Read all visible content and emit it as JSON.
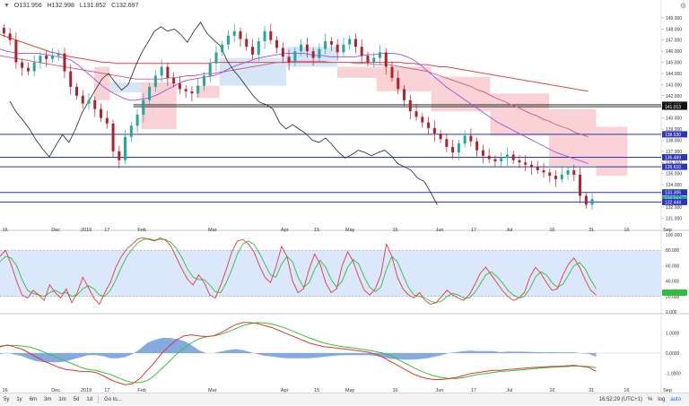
{
  "header": {
    "ohlc": [
      "O131.956",
      "H132.998",
      "L131.852",
      "C132.697"
    ]
  },
  "chart_data": {
    "type": "candlestick",
    "y_ticks": [
      131.0,
      132.0,
      133.0,
      134.0,
      135.0,
      136.0,
      137.0,
      138.0,
      139.0,
      140.0,
      141.0,
      142.0,
      143.0,
      144.0,
      145.0,
      146.0,
      147.0,
      148.0,
      149.0
    ],
    "ylim": [
      130.3,
      149.8
    ],
    "x_labels": [
      {
        "label": "16",
        "t": 0.03
      },
      {
        "label": "Dec",
        "t": 0.28
      },
      {
        "label": "2019",
        "t": 0.43
      },
      {
        "label": "17",
        "t": 0.55
      },
      {
        "label": "Feb",
        "t": 0.72
      },
      {
        "label": "Mar",
        "t": 1.08
      },
      {
        "label": "Apr",
        "t": 1.45
      },
      {
        "label": "15",
        "t": 1.62
      },
      {
        "label": "May",
        "t": 1.78
      },
      {
        "label": "16",
        "t": 2.02
      },
      {
        "label": "Jun",
        "t": 2.24
      },
      {
        "label": "17",
        "t": 2.42
      },
      {
        "label": "Jul",
        "t": 2.6
      },
      {
        "label": "16",
        "t": 2.82
      },
      {
        "label": "31",
        "t": 3.02
      },
      {
        "label": "16",
        "t": 3.2
      },
      {
        "label": "Sep",
        "t": 3.4
      }
    ],
    "closes": [
      147.6,
      147.0,
      145.0,
      144.5,
      144.2,
      145.0,
      145.6,
      145.3,
      145.6,
      145.8,
      144.2,
      142.8,
      142.0,
      141.3,
      141.6,
      140.8,
      140.0,
      139.5,
      137.0,
      136.2,
      138.3,
      139.3,
      140.3,
      141.6,
      142.8,
      143.8,
      144.6,
      143.6,
      143.1,
      142.6,
      142.4,
      142.2,
      142.9,
      143.8,
      144.9,
      145.9,
      146.6,
      147.4,
      147.8,
      147.1,
      146.4,
      145.7,
      146.9,
      147.8,
      147.0,
      146.3,
      145.5,
      145.0,
      146.0,
      146.6,
      146.0,
      145.4,
      146.2,
      146.9,
      146.6,
      145.9,
      146.6,
      147.1,
      146.4,
      145.6,
      145.0,
      145.4,
      145.9,
      144.6,
      143.6,
      142.6,
      141.6,
      140.6,
      140.1,
      139.6,
      139.1,
      138.6,
      138.1,
      137.4,
      136.9,
      137.7,
      138.4,
      137.9,
      137.1,
      136.6,
      136.3,
      136.1,
      136.4,
      136.7,
      136.2,
      136.0,
      135.8,
      135.6,
      135.3,
      135.1,
      134.8,
      134.5,
      134.9,
      135.3,
      134.9,
      133.0,
      132.2,
      132.7
    ],
    "ma_fast": [
      146.2,
      146.0,
      145.9,
      145.8,
      145.8,
      145.8,
      145.8,
      145.7,
      145.6,
      145.5,
      145.4,
      145.2,
      144.8,
      144.3,
      143.8,
      143.3,
      142.8,
      142.4,
      142.1,
      141.8,
      141.6,
      141.6,
      141.7,
      141.8,
      142.0,
      142.3,
      142.6,
      142.9,
      143.2,
      143.4,
      143.5,
      143.6,
      143.7,
      143.8,
      144.0,
      144.3,
      144.6,
      144.8,
      145.0,
      145.2,
      145.4,
      145.5,
      145.6,
      145.7,
      145.8,
      145.8,
      145.8,
      145.8,
      145.7,
      145.6,
      145.6,
      145.5,
      145.5,
      145.5,
      145.5,
      145.5,
      145.6,
      145.7,
      145.7,
      145.8,
      145.8,
      145.8,
      145.7,
      145.5,
      145.2,
      144.8,
      144.3,
      143.8,
      143.3,
      142.8,
      142.4,
      142.0,
      141.6,
      141.2,
      140.8,
      140.4,
      140.0,
      139.6,
      139.3,
      139.0,
      138.7,
      138.4,
      138.1,
      137.8,
      137.5,
      137.2,
      136.9,
      136.7,
      136.5,
      136.3,
      136.1,
      135.9
    ],
    "ma_mid": [
      145.6,
      145.5,
      145.4,
      145.3,
      145.2,
      145.1,
      145.0,
      144.9,
      144.8,
      144.7,
      144.6,
      144.5,
      144.4,
      144.3,
      144.2,
      144.1,
      144.0,
      143.9,
      143.8,
      143.7,
      143.6,
      143.5,
      143.5,
      143.5,
      143.5,
      143.5,
      143.6,
      143.6,
      143.7,
      143.8,
      143.8,
      143.9,
      144.0,
      144.0,
      144.1,
      144.2,
      144.3,
      144.4,
      144.5,
      144.6,
      144.7,
      144.8,
      144.9,
      145.0,
      145.0,
      145.1,
      145.1,
      145.1,
      145.1,
      145.1,
      145.1,
      145.0,
      145.0,
      145.0,
      145.0,
      144.9,
      144.9,
      144.9,
      144.8,
      144.8,
      144.8,
      144.7,
      144.6,
      144.5,
      144.4,
      144.3,
      144.2,
      144.0,
      143.8,
      143.6,
      143.4,
      143.2,
      143.0,
      142.8,
      142.5,
      142.3,
      142.0,
      141.7,
      141.5,
      141.2,
      141.0,
      140.7,
      140.4,
      140.2,
      139.9,
      139.7,
      139.4,
      139.2,
      139.0,
      138.7,
      138.5,
      138.3
    ],
    "ma_slow": [
      147.5,
      147.3,
      147.1,
      146.9,
      146.7,
      146.5,
      146.3,
      146.1,
      145.9,
      145.8,
      145.6,
      145.5,
      145.4,
      145.3,
      145.2,
      145.1,
      145.0,
      145.0,
      144.9,
      144.9,
      144.9,
      144.9,
      144.9,
      144.9,
      144.9,
      144.9,
      144.9,
      144.9,
      144.9,
      144.9,
      144.9,
      144.9,
      144.9,
      145.0,
      145.0,
      145.0,
      145.0,
      145.0,
      145.0,
      145.0,
      145.0,
      145.0,
      145.0,
      145.0,
      145.0,
      145.0,
      145.0,
      145.0,
      145.0,
      145.0,
      145.0,
      145.0,
      145.0,
      145.0,
      145.0,
      145.0,
      145.0,
      145.0,
      145.0,
      145.0,
      145.0,
      145.0,
      145.0,
      144.9,
      144.9,
      144.8,
      144.8,
      144.7,
      144.6,
      144.6,
      144.5,
      144.4,
      144.3,
      144.2,
      144.1,
      144.0,
      143.9,
      143.8,
      143.7,
      143.6,
      143.5,
      143.4,
      143.3,
      143.2,
      143.1,
      143.0,
      142.9,
      142.8,
      142.7,
      142.6,
      142.5,
      142.4
    ],
    "lagging": [
      141.5,
      140.5,
      139.8,
      139.0,
      138.0,
      137.2,
      136.5,
      137.5,
      138.5,
      137.8,
      139.0,
      140.5,
      141.5,
      142.5,
      143.5,
      144.0,
      143.2,
      142.5,
      143.0,
      144.5,
      145.8,
      146.8,
      147.8,
      148.2,
      147.8,
      148.0,
      147.5,
      146.8,
      147.8,
      148.6,
      147.6,
      147.0,
      146.5,
      145.2,
      144.3,
      143.6,
      142.8,
      142.0,
      141.4,
      141.2,
      140.8,
      139.6,
      139.0,
      139.4,
      139.0,
      138.6,
      138.0,
      137.8,
      138.2,
      137.6,
      136.9,
      136.4,
      136.7,
      137.1,
      136.9,
      136.6,
      136.9,
      137.1,
      136.6,
      135.9,
      135.6,
      135.3,
      134.6,
      134.3,
      133.3,
      132.2
    ],
    "cloud_green": [
      {
        "from": 0.56,
        "to": 0.72,
        "top": 143.2,
        "bottom": 142.3
      },
      {
        "from": 1.12,
        "to": 1.46,
        "top": 145.4,
        "bottom": 142.9
      },
      {
        "from": 1.46,
        "to": 1.72,
        "top": 146.4,
        "bottom": 144.6
      }
    ],
    "cloud_red": [
      {
        "from": 0.48,
        "to": 0.56,
        "top": 144.6,
        "bottom": 141.6
      },
      {
        "from": 0.72,
        "to": 0.9,
        "top": 143.2,
        "bottom": 139.0
      },
      {
        "from": 1.0,
        "to": 1.12,
        "top": 142.9,
        "bottom": 141.8
      },
      {
        "from": 1.72,
        "to": 1.92,
        "top": 144.6,
        "bottom": 143.6
      },
      {
        "from": 1.92,
        "to": 2.2,
        "top": 144.6,
        "bottom": 142.4
      },
      {
        "from": 2.2,
        "to": 2.5,
        "top": 143.7,
        "bottom": 140.6
      },
      {
        "from": 2.5,
        "to": 2.8,
        "top": 142.2,
        "bottom": 138.4
      },
      {
        "from": 2.8,
        "to": 3.04,
        "top": 140.8,
        "bottom": 135.7
      },
      {
        "from": 3.04,
        "to": 3.2,
        "top": 139.2,
        "bottom": 134.8
      }
    ],
    "levels": [
      {
        "label": "141.183",
        "value": 141.183,
        "color": "#111111"
      },
      {
        "label": "141.013",
        "value": 141.013,
        "color": "#111111"
      },
      {
        "label": "138.530",
        "value": 138.53,
        "color": "#2a35b8"
      },
      {
        "label": "136.469",
        "value": 136.469,
        "color": "#2a35b8"
      },
      {
        "label": "135.610",
        "value": 135.61,
        "color": "#2a35b8"
      },
      {
        "label": "133.306",
        "value": 133.306,
        "color": "#2a35b8"
      },
      {
        "label": "132.697",
        "value": 132.697,
        "color": "#26a69a"
      },
      {
        "label": "132.444",
        "value": 132.444,
        "color": "#2a35b8"
      }
    ],
    "stoch": {
      "y_ticks": [
        0.0,
        20.0,
        40.0,
        60.0,
        80.0,
        100.0
      ],
      "band": [
        20,
        80
      ],
      "k": [
        72,
        80,
        62,
        40,
        22,
        18,
        28,
        22,
        15,
        35,
        25,
        18,
        30,
        12,
        25,
        45,
        32,
        18,
        10,
        25,
        38,
        58,
        72,
        82,
        88,
        95,
        96,
        94,
        92,
        96,
        93,
        85,
        70,
        55,
        42,
        35,
        48,
        38,
        22,
        18,
        35,
        55,
        78,
        92,
        94,
        88,
        78,
        60,
        45,
        38,
        58,
        85,
        72,
        40,
        25,
        30,
        55,
        75,
        62,
        38,
        25,
        30,
        60,
        78,
        65,
        45,
        28,
        22,
        30,
        48,
        88,
        72,
        45,
        30,
        22,
        18,
        25,
        15,
        10,
        12,
        20,
        28,
        22,
        18,
        15,
        22,
        35,
        50,
        58,
        48,
        38,
        28,
        20,
        15,
        18,
        25,
        45,
        58,
        50,
        38,
        28,
        30,
        48,
        62,
        70,
        58,
        42,
        28,
        22
      ],
      "d": [
        65,
        72,
        70,
        60,
        42,
        28,
        24,
        22,
        20,
        25,
        28,
        24,
        25,
        20,
        22,
        30,
        34,
        30,
        22,
        20,
        28,
        42,
        58,
        72,
        82,
        90,
        94,
        95,
        93,
        94,
        94,
        90,
        82,
        70,
        55,
        45,
        42,
        42,
        35,
        26,
        25,
        38,
        55,
        75,
        88,
        92,
        88,
        76,
        62,
        48,
        45,
        62,
        72,
        65,
        45,
        32,
        38,
        55,
        67,
        58,
        42,
        32,
        40,
        58,
        68,
        62,
        45,
        32,
        26,
        32,
        55,
        72,
        65,
        48,
        32,
        22,
        20,
        18,
        14,
        12,
        14,
        20,
        24,
        22,
        18,
        18,
        25,
        36,
        48,
        52,
        46,
        38,
        28,
        22,
        18,
        20,
        30,
        45,
        52,
        48,
        38,
        32,
        36,
        48,
        60,
        64,
        56,
        42,
        30
      ],
      "last": 25
    },
    "macd": {
      "y_ticks": [
        {
          "label": "1.0000",
          "v": 1.0
        },
        {
          "label": "0.0000",
          "v": 0
        },
        {
          "label": "-1.0000",
          "v": -1.0
        }
      ],
      "macd": [
        0.3,
        0.4,
        0.3,
        0.2,
        0.0,
        -0.2,
        -0.4,
        -0.55,
        -0.7,
        -0.8,
        -0.85,
        -0.9,
        -0.9,
        -0.95,
        -1.1,
        -1.3,
        -1.45,
        -1.55,
        -1.5,
        -1.25,
        -0.85,
        -0.45,
        0.0,
        0.35,
        0.65,
        0.85,
        0.9,
        0.85,
        0.8,
        0.85,
        1.0,
        1.2,
        1.4,
        1.5,
        1.5,
        1.45,
        1.35,
        1.25,
        1.1,
        0.95,
        0.8,
        0.65,
        0.5,
        0.4,
        0.32,
        0.28,
        0.24,
        0.2,
        0.15,
        0.1,
        0.05,
        -0.05,
        -0.2,
        -0.4,
        -0.6,
        -0.8,
        -1.0,
        -1.15,
        -1.25,
        -1.3,
        -1.3,
        -1.25,
        -1.2,
        -1.1,
        -1.0,
        -0.95,
        -0.9,
        -0.85,
        -0.85,
        -0.8,
        -0.78,
        -0.75,
        -0.72,
        -0.7,
        -0.68,
        -0.65,
        -0.65,
        -0.62,
        -0.6,
        -0.65,
        -0.7,
        -0.9
      ],
      "signal": [
        0.35,
        0.38,
        0.38,
        0.35,
        0.3,
        0.2,
        0.05,
        -0.1,
        -0.25,
        -0.4,
        -0.55,
        -0.7,
        -0.8,
        -0.85,
        -0.95,
        -1.05,
        -1.2,
        -1.35,
        -1.45,
        -1.45,
        -1.35,
        -1.1,
        -0.75,
        -0.4,
        -0.05,
        0.25,
        0.5,
        0.7,
        0.8,
        0.85,
        0.92,
        1.05,
        1.2,
        1.35,
        1.45,
        1.5,
        1.48,
        1.42,
        1.32,
        1.2,
        1.05,
        0.9,
        0.75,
        0.62,
        0.5,
        0.42,
        0.35,
        0.3,
        0.25,
        0.2,
        0.15,
        0.08,
        0.0,
        -0.12,
        -0.3,
        -0.48,
        -0.68,
        -0.85,
        -1.0,
        -1.12,
        -1.2,
        -1.25,
        -1.25,
        -1.2,
        -1.12,
        -1.05,
        -1.0,
        -0.95,
        -0.9,
        -0.88,
        -0.85,
        -0.82,
        -0.78,
        -0.75,
        -0.72,
        -0.7,
        -0.68,
        -0.66,
        -0.64,
        -0.64,
        -0.66,
        -0.72
      ],
      "hist": [
        -0.05,
        0.02,
        -0.08,
        -0.15,
        -0.3,
        -0.4,
        -0.45,
        -0.45,
        -0.45,
        -0.4,
        -0.3,
        -0.2,
        -0.1,
        -0.1,
        -0.15,
        -0.25,
        -0.25,
        -0.2,
        -0.05,
        0.2,
        0.5,
        0.65,
        0.75,
        0.75,
        0.7,
        0.6,
        0.4,
        0.15,
        0.0,
        0.0,
        0.08,
        0.15,
        0.2,
        0.15,
        0.05,
        -0.05,
        -0.13,
        -0.17,
        -0.22,
        -0.25,
        -0.25,
        -0.25,
        -0.25,
        -0.22,
        -0.18,
        -0.14,
        -0.11,
        -0.1,
        -0.1,
        -0.1,
        -0.1,
        -0.13,
        -0.2,
        -0.28,
        -0.3,
        -0.32,
        -0.32,
        -0.3,
        -0.25,
        -0.18,
        -0.1,
        0.0,
        0.05,
        0.1,
        0.12,
        0.1,
        0.1,
        0.1,
        0.05,
        0.08,
        0.07,
        0.07,
        0.06,
        0.05,
        0.04,
        0.05,
        0.03,
        0.04,
        0.04,
        -0.01,
        -0.04,
        -0.18
      ]
    }
  },
  "toolbar": {
    "timeframes": [
      "5y",
      "1y",
      "6m",
      "3m",
      "1m",
      "5d",
      "1d",
      "Go to..."
    ],
    "timestamp": "16:52:29 (UTC+1)",
    "pct": "%",
    "log": "log",
    "auto": "auto"
  }
}
